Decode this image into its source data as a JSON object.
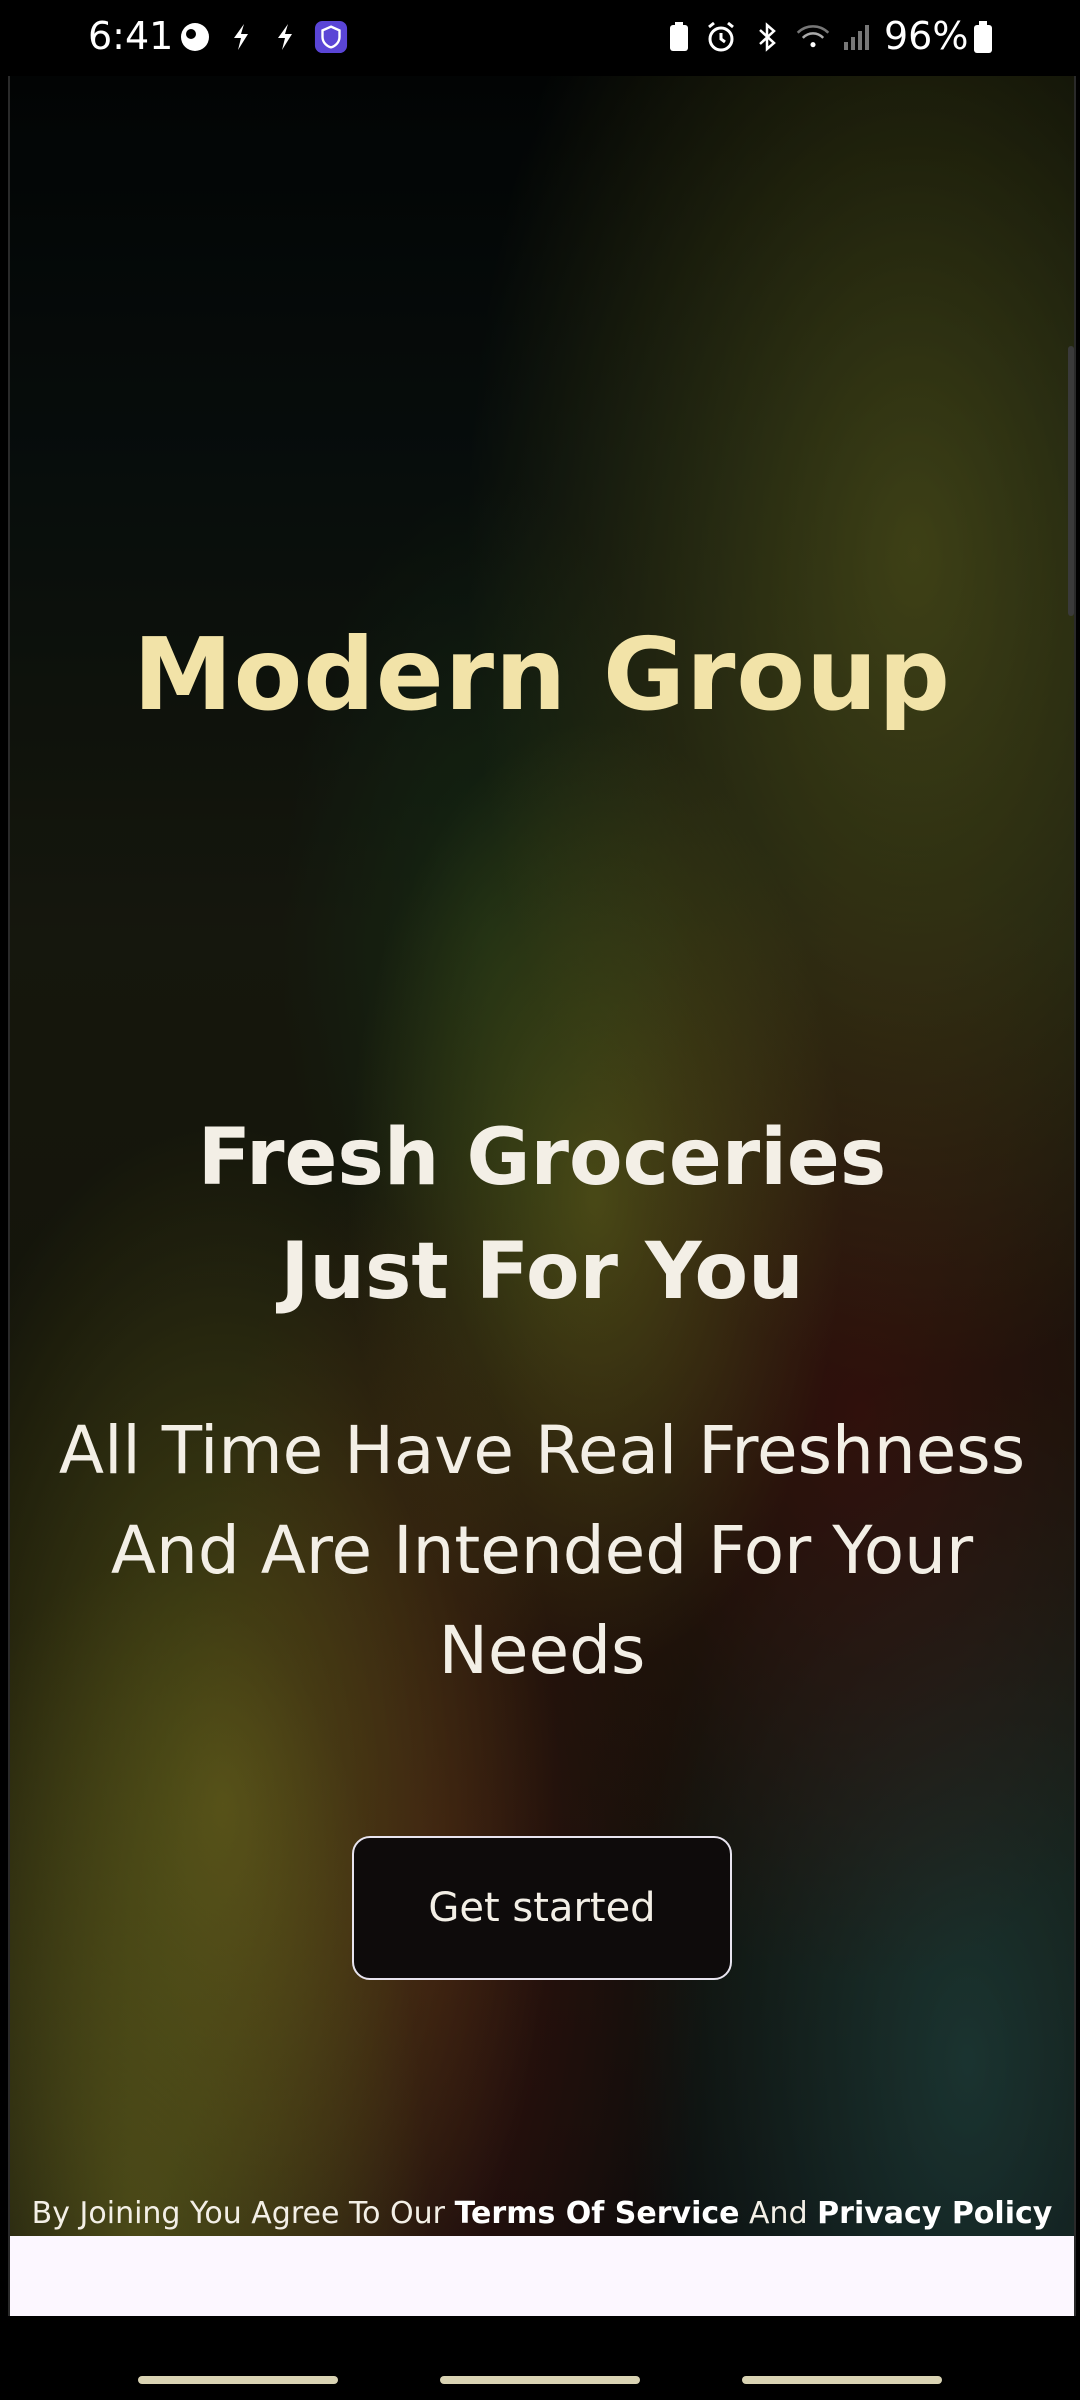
{
  "status_bar": {
    "time": "6:41",
    "battery_percent": "96%"
  },
  "app": {
    "title": "Modern Group",
    "heading": "Fresh Groceries Just For You",
    "subtitle": "All Time Have Real Freshness And Are Intended For Your Needs",
    "cta_label": "Get started",
    "terms": {
      "prefix": "By Joining You Agree To Our",
      "terms_link": "Terms Of Service",
      "connector": "And",
      "privacy_link": "Privacy Policy"
    }
  },
  "colors": {
    "title": "#f2e3a8",
    "text": "#f3efe6",
    "button_bg": "#0e0b0b",
    "bottom_strip": "#fcf7ff"
  }
}
